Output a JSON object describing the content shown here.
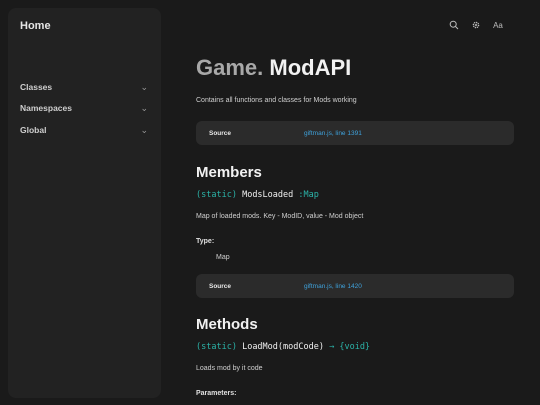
{
  "sidebar": {
    "home": "Home",
    "items": [
      {
        "label": "Classes",
        "chevron": "⌄"
      },
      {
        "label": "Namespaces",
        "chevron": "⌄"
      },
      {
        "label": "Global",
        "chevron": "⌄"
      }
    ]
  },
  "toolbar": {
    "icons": [
      "search-icon",
      "gear-icon",
      "font-size-icon"
    ],
    "font_glyph": "Aa"
  },
  "page": {
    "title_prefix": "Game.",
    "title_name": "ModAPI",
    "description": "Contains all functions and classes for Mods working",
    "source_label": "Source",
    "source_link": "giftman.js, line 1391"
  },
  "members": {
    "heading": "Members",
    "items": [
      {
        "keyword": "(static)",
        "name": "ModsLoaded",
        "type": ":Map",
        "description": "Map of loaded mods. Key - ModID, value - Mod object",
        "type_label": "Type:",
        "type_value": "Map",
        "source_label": "Source",
        "source_link": "giftman.js, line 1420"
      }
    ]
  },
  "methods": {
    "heading": "Methods",
    "items": [
      {
        "keyword": "(static)",
        "name": "LoadMod(modCode)",
        "arrow": "→",
        "returns": "{void}",
        "description": "Loads mod by it code",
        "params_label": "Parameters:"
      }
    ]
  },
  "colors": {
    "background": "#1a1a1a",
    "sidebar": "#222222",
    "accent_teal": "#2bb3a8",
    "link_blue": "#3fa2dc"
  }
}
